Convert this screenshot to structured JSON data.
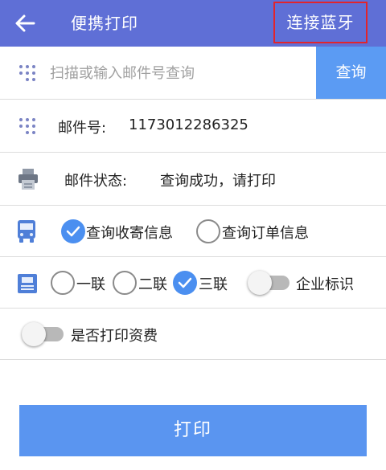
{
  "appbar": {
    "title": "便携打印",
    "bluetooth_button": "连接蓝牙",
    "color": "#5f6fd6"
  },
  "search": {
    "placeholder": "扫描或输入邮件号查询",
    "value": "",
    "query_button": "查询"
  },
  "mail": {
    "number_label": "邮件号:",
    "number_value": "1173012286325",
    "status_label": "邮件状态:",
    "status_value": "查询成功，请打印"
  },
  "query_type": {
    "options": [
      "查询收寄信息",
      "查询订单信息"
    ],
    "selected": "查询收寄信息"
  },
  "copies": {
    "options": [
      "一联",
      "二联",
      "三联"
    ],
    "selected": "三联",
    "enterprise_toggle_label": "企业标识",
    "enterprise_toggle_on": false
  },
  "fee": {
    "toggle_label": "是否打印资费",
    "toggle_on": false
  },
  "print_button": "打印",
  "icons": [
    "back-arrow-icon",
    "dots-icon",
    "printer-icon",
    "truck-icon",
    "form-icon",
    "check-icon"
  ],
  "colors": {
    "accent": "#4b8ff0",
    "button": "#5a95f0",
    "highlight_border": "#e2242c"
  }
}
